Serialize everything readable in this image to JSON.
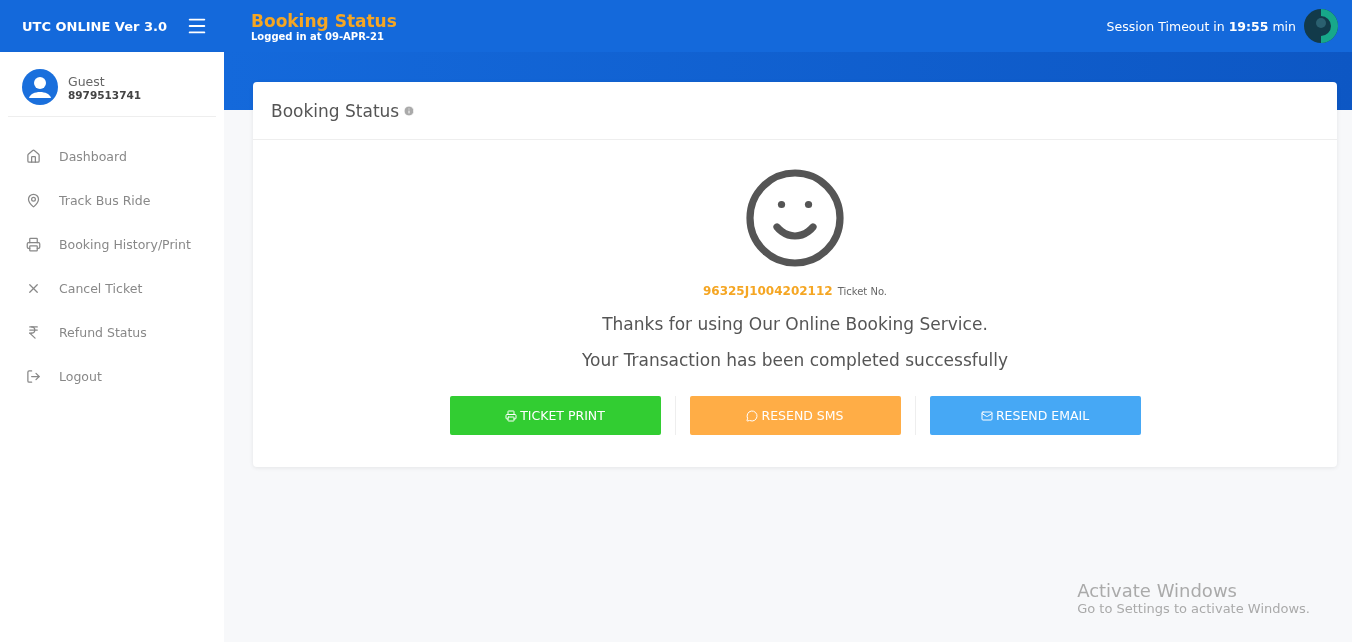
{
  "header": {
    "brand": "UTC ONLINE Ver 3.0",
    "page_title": "Booking Status",
    "login_info": "Logged in at 09-APR-21",
    "session": "Session Timeout in **19:55** min"
  },
  "user": {
    "name": "Guest",
    "phone": "8979513741"
  },
  "sidebar": {
    "items": [
      {
        "label": "Dashboard",
        "kind": "home"
      },
      {
        "label": "Track Bus Ride",
        "kind": "pin"
      },
      {
        "label": "Booking History/Print",
        "kind": "print"
      },
      {
        "label": "Cancel Ticket",
        "kind": "cancel"
      },
      {
        "label": "Refund Status",
        "kind": "rupee"
      },
      {
        "label": "Logout",
        "kind": "logout"
      }
    ]
  },
  "card": {
    "title": "Booking Status",
    "ticket_number": "96325J1004202112",
    "ticket_label": "Ticket No.",
    "messages": [
      "Thanks for using Our Online Booking Service.",
      "Your Transaction has been completed successfully"
    ],
    "buttons": [
      {
        "label": "TICKET PRINT",
        "kind": "print",
        "color": "#32cd32"
      },
      {
        "label": "RESEND SMS",
        "kind": "sms",
        "color": "#ffad46"
      },
      {
        "label": "RESEND EMAIL",
        "kind": "email",
        "color": "#46a8f5"
      }
    ]
  },
  "windows_notice": {
    "title": "Activate Windows",
    "text": "Go to Settings to activate Windows."
  }
}
